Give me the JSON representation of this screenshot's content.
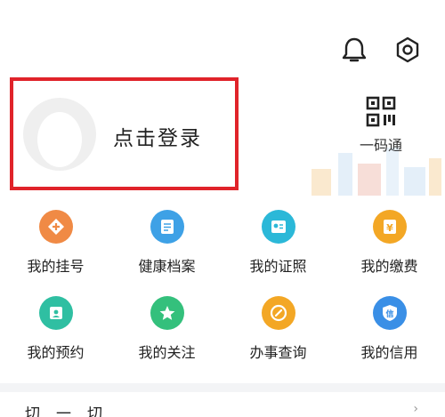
{
  "topbar": {
    "bell_icon": "bell-icon",
    "settings_icon": "gear-icon"
  },
  "login": {
    "label": "点击登录",
    "border_color": "#e0232a"
  },
  "qr": {
    "icon": "qrcode-icon",
    "label": "一码通"
  },
  "grid": {
    "items": [
      {
        "label": "我的挂号",
        "icon": "register-icon",
        "color": "#f08a45"
      },
      {
        "label": "健康档案",
        "icon": "archive-icon",
        "color": "#3ea1e6"
      },
      {
        "label": "我的证照",
        "icon": "certificate-icon",
        "color": "#2bb8d8"
      },
      {
        "label": "我的缴费",
        "icon": "payment-icon",
        "color": "#f3a725"
      },
      {
        "label": "我的预约",
        "icon": "appointment-icon",
        "color": "#2fbfa2"
      },
      {
        "label": "我的关注",
        "icon": "star-icon",
        "color": "#34c07c"
      },
      {
        "label": "办事查询",
        "icon": "search-query-icon",
        "color": "#f3a725"
      },
      {
        "label": "我的信用",
        "icon": "credit-icon",
        "color": "#3a8fe6"
      }
    ]
  },
  "bottom": {
    "partial_text": "切一切"
  }
}
